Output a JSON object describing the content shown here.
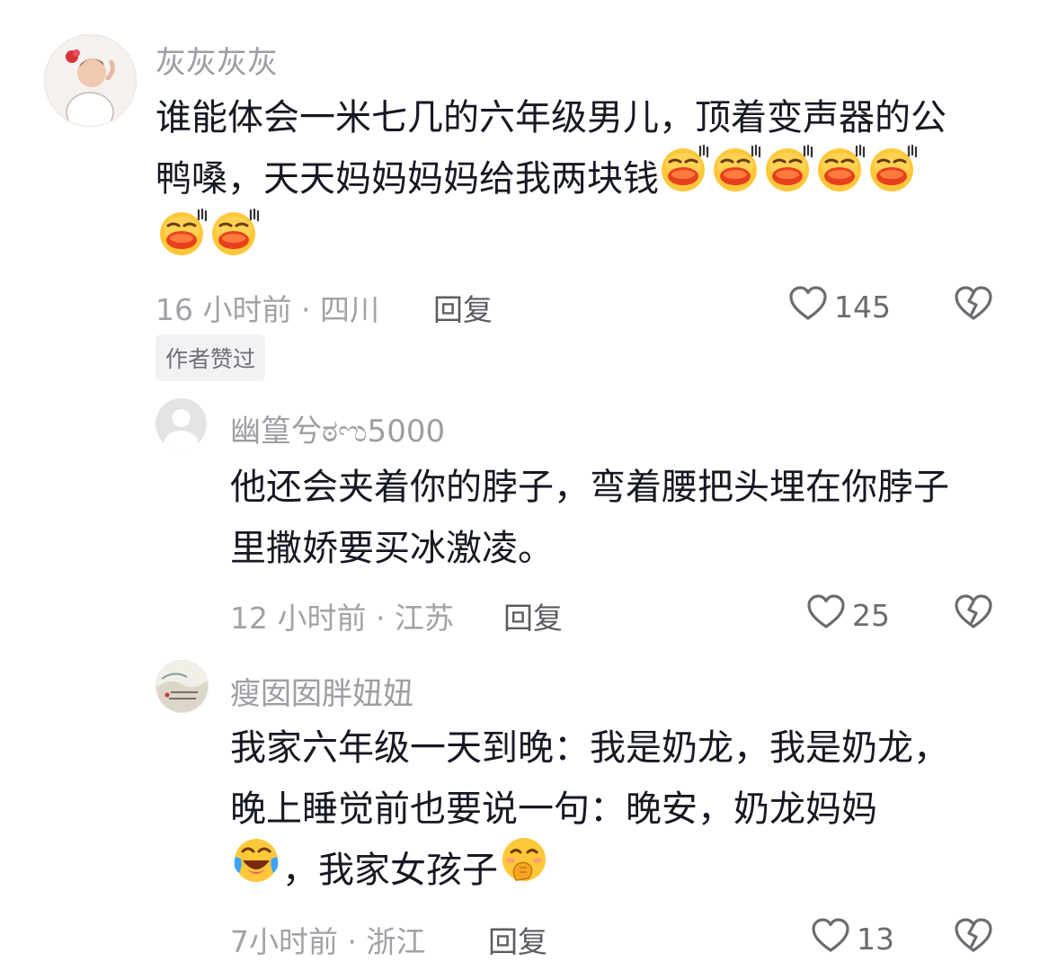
{
  "comments": [
    {
      "username": "灰灰灰灰",
      "lines": [
        "谁能体会一米七几的六年级男儿，顶着变声器的公",
        "鸭嗓，天天妈妈妈妈给我两块钱"
      ],
      "emoji": "cheeky-tongue-emoji",
      "emoji_count": 7,
      "time_location": "16 小时前 · 四川",
      "reply_label": "回复",
      "likes": "145",
      "tag": "作者赞过"
    },
    {
      "username": "幽篁兮ಠಌ5000",
      "lines": [
        "他还会夹着你的脖子，弯着腰把头埋在你脖子",
        "里撒娇要买冰激凌。"
      ],
      "time_location": "12 小时前 · 江苏",
      "reply_label": "回复",
      "likes": "25"
    },
    {
      "username": "瘦囡囡胖妞妞",
      "lines": [
        "我家六年级一天到晚：我是奶龙，我是奶龙，",
        "晚上睡觉前也要说一句：晚安，奶龙妈妈",
        "，我家女孩子"
      ],
      "emojis": [
        "crying-laughing-emoji",
        "hand-over-mouth-emoji"
      ],
      "time_location": "7小时前 · 浙江",
      "reply_label": "回复",
      "likes": "13"
    }
  ],
  "icons": [
    "heart-outline-icon",
    "broken-heart-icon"
  ]
}
